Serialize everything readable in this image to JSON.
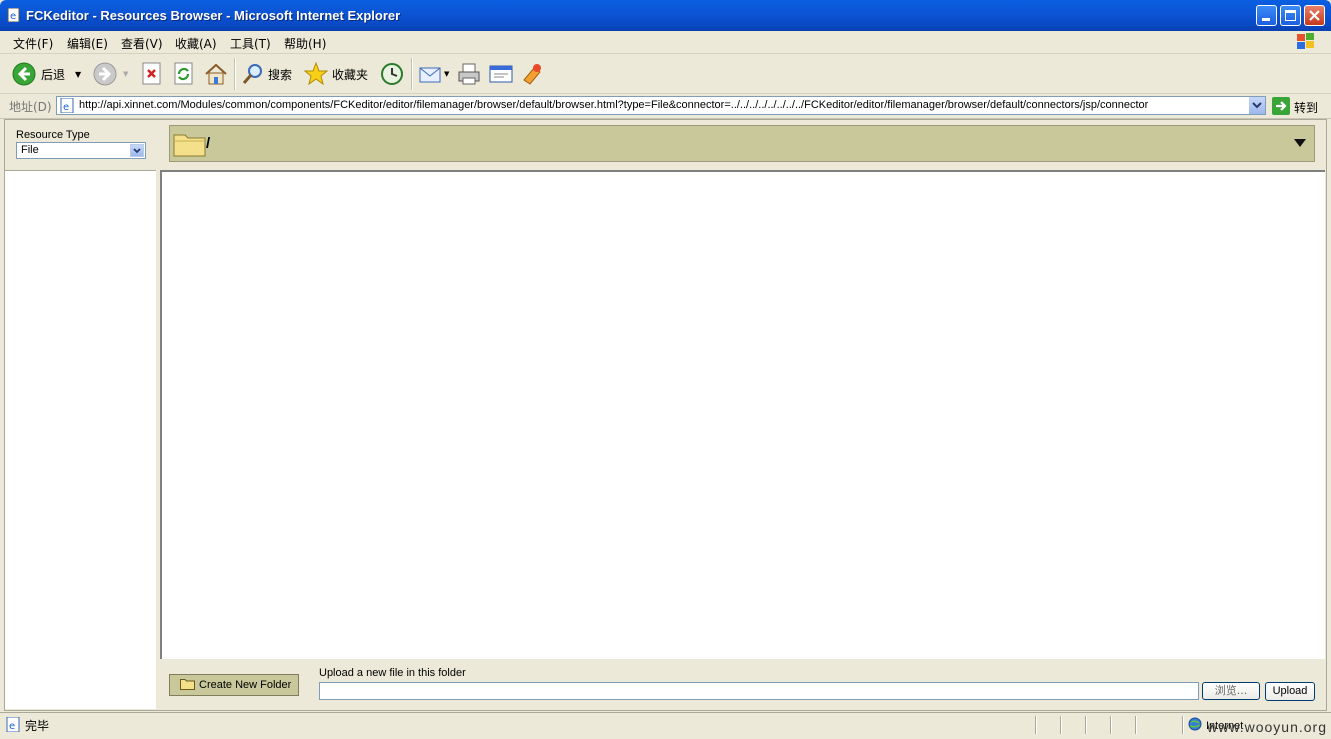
{
  "window": {
    "title": "FCKeditor - Resources Browser - Microsoft Internet Explorer"
  },
  "menu": [
    {
      "label": "文件(F)"
    },
    {
      "label": "编辑(E)"
    },
    {
      "label": "查看(V)"
    },
    {
      "label": "收藏(A)"
    },
    {
      "label": "工具(T)"
    },
    {
      "label": "帮助(H)"
    }
  ],
  "toolbar": {
    "back_label": "后退",
    "search_label": "搜索",
    "favorites_label": "收藏夹"
  },
  "address": {
    "label": "地址(D)",
    "url": "http://api.xinnet.com/Modules/common/components/FCKeditor/editor/filemanager/browser/default/browser.html?type=File&connector=../../../../../../../../FCKeditor/editor/filemanager/browser/default/connectors/jsp/connector",
    "go_label": "转到"
  },
  "browser": {
    "resource_type_label": "Resource Type",
    "resource_type_value": "File",
    "current_path": "/",
    "create_folder_label": "Create New Folder",
    "upload_label": "Upload a new file in this folder",
    "browse_label": "浏览...",
    "upload_button": "Upload"
  },
  "status": {
    "text": "完毕",
    "zone": "Internet",
    "watermark": "www.wooyun.org"
  },
  "colors": {
    "titlebar": "#0a55d6",
    "chrome": "#ece9d8",
    "fck_bar": "#c8c89a"
  }
}
